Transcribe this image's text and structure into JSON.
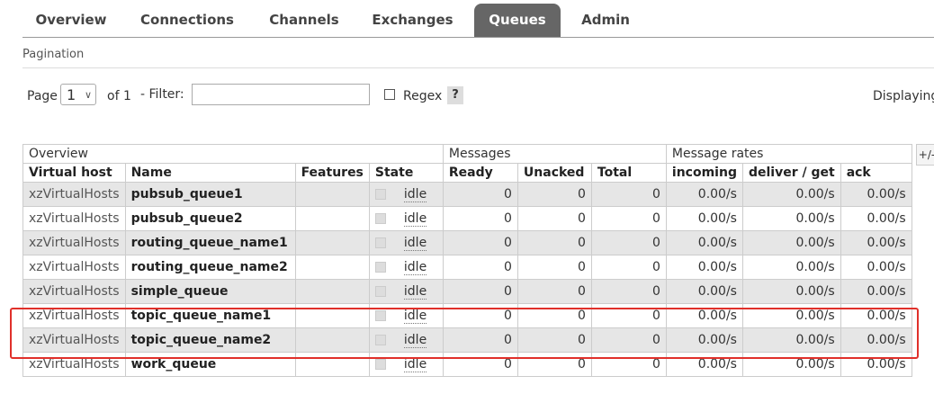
{
  "tabs": [
    {
      "label": "Overview",
      "active": false
    },
    {
      "label": "Connections",
      "active": false
    },
    {
      "label": "Channels",
      "active": false
    },
    {
      "label": "Exchanges",
      "active": false
    },
    {
      "label": "Queues",
      "active": true
    },
    {
      "label": "Admin",
      "active": false
    }
  ],
  "section_title": "Pagination",
  "pagination": {
    "page_label": "Page",
    "page_value": "1",
    "of_label": "of 1",
    "filter_label": "- Filter:",
    "filter_value": "",
    "regex_label": "Regex",
    "help_label": "?",
    "displaying_label": "Displaying"
  },
  "table": {
    "group_headers": [
      "Overview",
      "Messages",
      "Message rates"
    ],
    "columns": [
      "Virtual host",
      "Name",
      "Features",
      "State",
      "Ready",
      "Unacked",
      "Total",
      "incoming",
      "deliver / get",
      "ack"
    ],
    "toggle_label": "+/-",
    "rows": [
      {
        "vhost": "xzVirtualHosts",
        "name": "pubsub_queue1",
        "features": "",
        "state": "idle",
        "ready": "0",
        "unacked": "0",
        "total": "0",
        "incoming": "0.00/s",
        "deliver": "0.00/s",
        "ack": "0.00/s"
      },
      {
        "vhost": "xzVirtualHosts",
        "name": "pubsub_queue2",
        "features": "",
        "state": "idle",
        "ready": "0",
        "unacked": "0",
        "total": "0",
        "incoming": "0.00/s",
        "deliver": "0.00/s",
        "ack": "0.00/s"
      },
      {
        "vhost": "xzVirtualHosts",
        "name": "routing_queue_name1",
        "features": "",
        "state": "idle",
        "ready": "0",
        "unacked": "0",
        "total": "0",
        "incoming": "0.00/s",
        "deliver": "0.00/s",
        "ack": "0.00/s"
      },
      {
        "vhost": "xzVirtualHosts",
        "name": "routing_queue_name2",
        "features": "",
        "state": "idle",
        "ready": "0",
        "unacked": "0",
        "total": "0",
        "incoming": "0.00/s",
        "deliver": "0.00/s",
        "ack": "0.00/s"
      },
      {
        "vhost": "xzVirtualHosts",
        "name": "simple_queue",
        "features": "",
        "state": "idle",
        "ready": "0",
        "unacked": "0",
        "total": "0",
        "incoming": "0.00/s",
        "deliver": "0.00/s",
        "ack": "0.00/s"
      },
      {
        "vhost": "xzVirtualHosts",
        "name": "topic_queue_name1",
        "features": "",
        "state": "idle",
        "ready": "0",
        "unacked": "0",
        "total": "0",
        "incoming": "0.00/s",
        "deliver": "0.00/s",
        "ack": "0.00/s"
      },
      {
        "vhost": "xzVirtualHosts",
        "name": "topic_queue_name2",
        "features": "",
        "state": "idle",
        "ready": "0",
        "unacked": "0",
        "total": "0",
        "incoming": "0.00/s",
        "deliver": "0.00/s",
        "ack": "0.00/s"
      },
      {
        "vhost": "xzVirtualHosts",
        "name": "work_queue",
        "features": "",
        "state": "idle",
        "ready": "0",
        "unacked": "0",
        "total": "0",
        "incoming": "0.00/s",
        "deliver": "0.00/s",
        "ack": "0.00/s"
      }
    ]
  },
  "colors": {
    "active_tab": "#666666",
    "highlight": "#e0302a",
    "row_alt": "#e6e6e6"
  }
}
